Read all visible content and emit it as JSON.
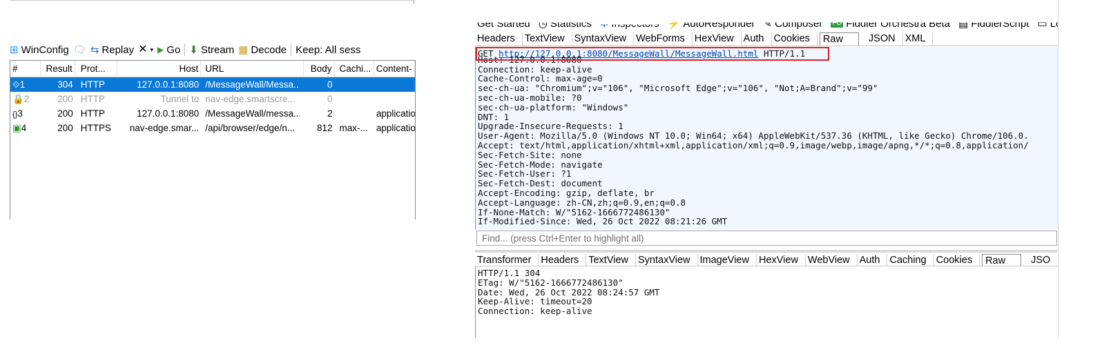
{
  "toolbar": {
    "winconfig": "WinConfig",
    "replay": "Replay",
    "go": "Go",
    "stream": "Stream",
    "decode": "Decode",
    "keep": "Keep: All sess"
  },
  "sessions": {
    "columns": [
      "#",
      "Result",
      "Prot...",
      "Host",
      "URL",
      "Body",
      "Cachi...",
      "Content-"
    ],
    "rows": [
      {
        "num": "1",
        "result": "304",
        "protocol": "HTTP",
        "host": "127.0.0.1:8080",
        "url": "/MessageWall/Messa...",
        "body": "0",
        "caching": "",
        "content_type": ""
      },
      {
        "num": "2",
        "result": "200",
        "protocol": "HTTP",
        "host": "Tunnel to",
        "url": "nav-edge.smartscre...",
        "body": "0",
        "caching": "",
        "content_type": ""
      },
      {
        "num": "3",
        "result": "200",
        "protocol": "HTTP",
        "host": "127.0.0.1:8080",
        "url": "/MessageWall/messa...",
        "body": "2",
        "caching": "",
        "content_type": "applicatio"
      },
      {
        "num": "4",
        "result": "200",
        "protocol": "HTTPS",
        "host": "nav-edge.smar...",
        "url": "/api/browser/edge/n...",
        "body": "812",
        "caching": "max-...",
        "content_type": "applicatio"
      }
    ]
  },
  "top_tabs": {
    "get_started": "Get Started",
    "statistics": "Statistics",
    "inspectors": "Inspectors",
    "autoresponder": "AutoResponder",
    "composer": "Composer",
    "orchestra": "Fiddler Orchestra Beta",
    "fiddlerscript": "FiddlerScript",
    "log": "Log"
  },
  "request_tabs": [
    "Headers",
    "TextView",
    "SyntaxView",
    "WebForms",
    "HexView",
    "Auth",
    "Cookies",
    "Raw",
    "JSON",
    "XML"
  ],
  "request": {
    "method": "GET",
    "url": "http://127.0.0.1:8080/MessageWall/MessageWall.html",
    "version": "HTTP/1.1",
    "headers": [
      "Host: 127.0.0.1:8080",
      "Connection: keep-alive",
      "Cache-Control: max-age=0",
      "sec-ch-ua: \"Chromium\";v=\"106\", \"Microsoft Edge\";v=\"106\", \"Not;A=Brand\";v=\"99\"",
      "sec-ch-ua-mobile: ?0",
      "sec-ch-ua-platform: \"Windows\"",
      "DNT: 1",
      "Upgrade-Insecure-Requests: 1",
      "User-Agent: Mozilla/5.0 (Windows NT 10.0; Win64; x64) AppleWebKit/537.36 (KHTML, like Gecko) Chrome/106.0.",
      "Accept: text/html,application/xhtml+xml,application/xml;q=0.9,image/webp,image/apng,*/*;q=0.8,application/",
      "Sec-Fetch-Site: none",
      "Sec-Fetch-Mode: navigate",
      "Sec-Fetch-User: ?1",
      "Sec-Fetch-Dest: document",
      "Accept-Encoding: gzip, deflate, br",
      "Accept-Language: zh-CN,zh;q=0.9,en;q=0.8",
      "If-None-Match: W/\"5162-1666772486130\"",
      "If-Modified-Since: Wed, 26 Oct 2022 08:21:26 GMT"
    ]
  },
  "find": {
    "placeholder": "Find... (press Ctrl+Enter to highlight all)"
  },
  "response_tabs": [
    "Transformer",
    "Headers",
    "TextView",
    "SyntaxView",
    "ImageView",
    "HexView",
    "WebView",
    "Auth",
    "Caching",
    "Cookies",
    "Raw",
    "JSO"
  ],
  "response": {
    "lines": [
      "HTTP/1.1 304",
      "ETag: W/\"5162-1666772486130\"",
      "Date: Wed, 26 Oct 2022 08:24:57 GMT",
      "Keep-Alive: timeout=20",
      "Connection: keep-alive"
    ]
  },
  "colors": {
    "selection": "#0a78d7",
    "highlight_box": "#e0202a",
    "request_bg": "#f0f7fe",
    "link": "#0645ad"
  }
}
